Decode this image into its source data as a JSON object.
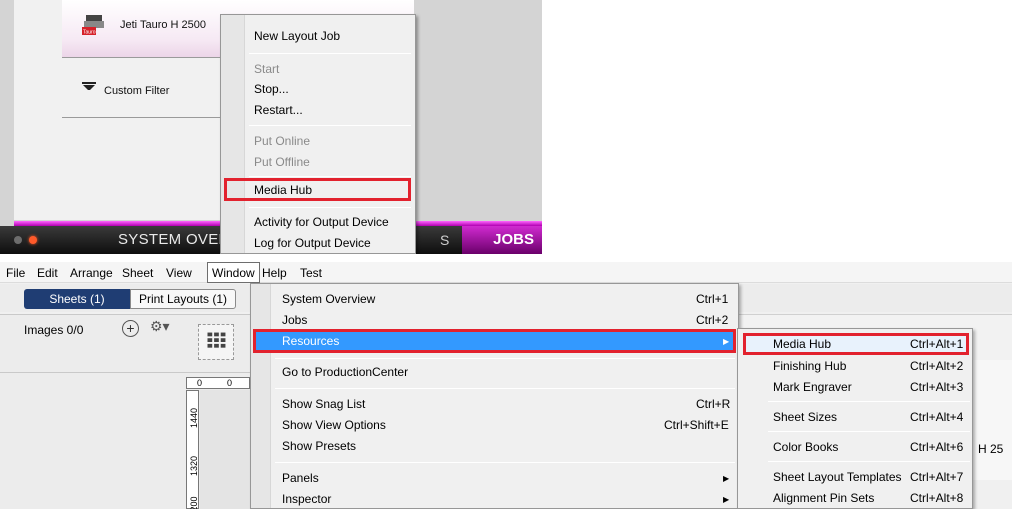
{
  "top_panel": {
    "device_name": "Jeti Tauro H 2500",
    "device_logo_text": "Tauro",
    "filter_label": "Custom Filter",
    "bottom_bar": {
      "system_overview": "SYSTEM OVER",
      "partial_tab": "S",
      "jobs": "JOBS"
    },
    "context_menu": {
      "items": [
        {
          "label": "New Layout Job",
          "enabled": true
        },
        {
          "label": "Start",
          "enabled": false
        },
        {
          "label": "Stop...",
          "enabled": true
        },
        {
          "label": "Restart...",
          "enabled": true
        },
        {
          "label": "Put Online",
          "enabled": false
        },
        {
          "label": "Put Offline",
          "enabled": false
        },
        {
          "label": "Media Hub",
          "enabled": true,
          "highlighted": true
        },
        {
          "label": "Activity for Output Device",
          "enabled": true
        },
        {
          "label": "Log for Output Device",
          "enabled": true
        }
      ]
    }
  },
  "bottom_panel": {
    "menubar": [
      "File",
      "Edit",
      "Arrange",
      "Sheet",
      "View",
      "Window",
      "Help",
      "Test"
    ],
    "active_menu": "Window",
    "tabs": {
      "sheets": "Sheets (1)",
      "print_layouts": "Print Layouts (1)"
    },
    "images_label": "Images 0/0",
    "ruler_h": [
      "0",
      "0"
    ],
    "ruler_v": [
      "1440",
      "1320",
      "200"
    ],
    "cut_label": "H 25",
    "window_menu": {
      "items": [
        {
          "label": "System Overview",
          "shortcut": "Ctrl+1"
        },
        {
          "label": "Jobs",
          "shortcut": "Ctrl+2"
        },
        {
          "label": "Resources",
          "shortcut": "",
          "submenu": true,
          "selected": true
        },
        {
          "label": "Go to ProductionCenter",
          "shortcut": ""
        },
        {
          "label": "Show Snag List",
          "shortcut": "Ctrl+R"
        },
        {
          "label": "Show View Options",
          "shortcut": "Ctrl+Shift+E"
        },
        {
          "label": "Show Presets",
          "shortcut": ""
        },
        {
          "label": "Panels",
          "shortcut": "",
          "submenu": true
        },
        {
          "label": "Inspector",
          "shortcut": "",
          "submenu": true
        }
      ]
    },
    "resources_submenu": {
      "items": [
        {
          "label": "Media Hub",
          "shortcut": "Ctrl+Alt+1",
          "highlighted": true
        },
        {
          "label": "Finishing Hub",
          "shortcut": "Ctrl+Alt+2"
        },
        {
          "label": "Mark Engraver",
          "shortcut": "Ctrl+Alt+3"
        },
        {
          "label": "Sheet Sizes",
          "shortcut": "Ctrl+Alt+4"
        },
        {
          "label": "Color Books",
          "shortcut": "Ctrl+Alt+6"
        },
        {
          "label": "Sheet Layout Templates",
          "shortcut": "Ctrl+Alt+7"
        },
        {
          "label": "Alignment Pin Sets",
          "shortcut": "Ctrl+Alt+8"
        }
      ]
    }
  },
  "colors": {
    "highlight_box": "#e2222e",
    "jobs_tab": "#c020c0",
    "menu_selection": "#3399ff",
    "sheets_tab": "#1f3d73"
  }
}
